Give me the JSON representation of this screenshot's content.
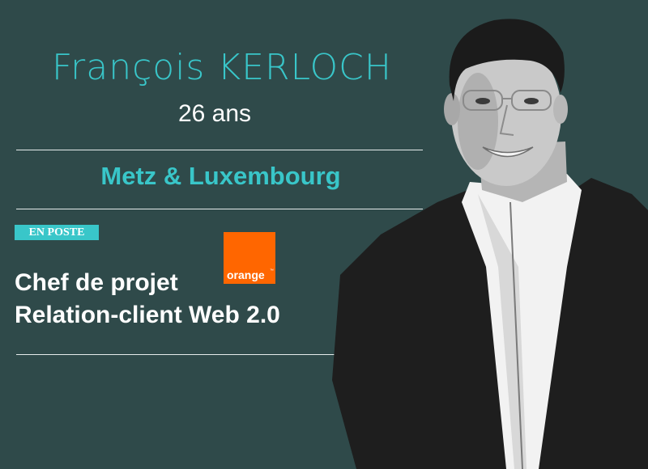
{
  "profile": {
    "name": "François KERLOCH",
    "age": "26 ans",
    "location": "Metz & Luxembourg",
    "status_badge": "EN POSTE",
    "role_line1": "Chef de projet",
    "role_line2": "Relation-client Web 2.0"
  },
  "logo": {
    "text": "orange",
    "color": "#ff6600"
  },
  "colors": {
    "background": "#2f4a4a",
    "accent": "#39c6c9",
    "text": "#ffffff"
  }
}
